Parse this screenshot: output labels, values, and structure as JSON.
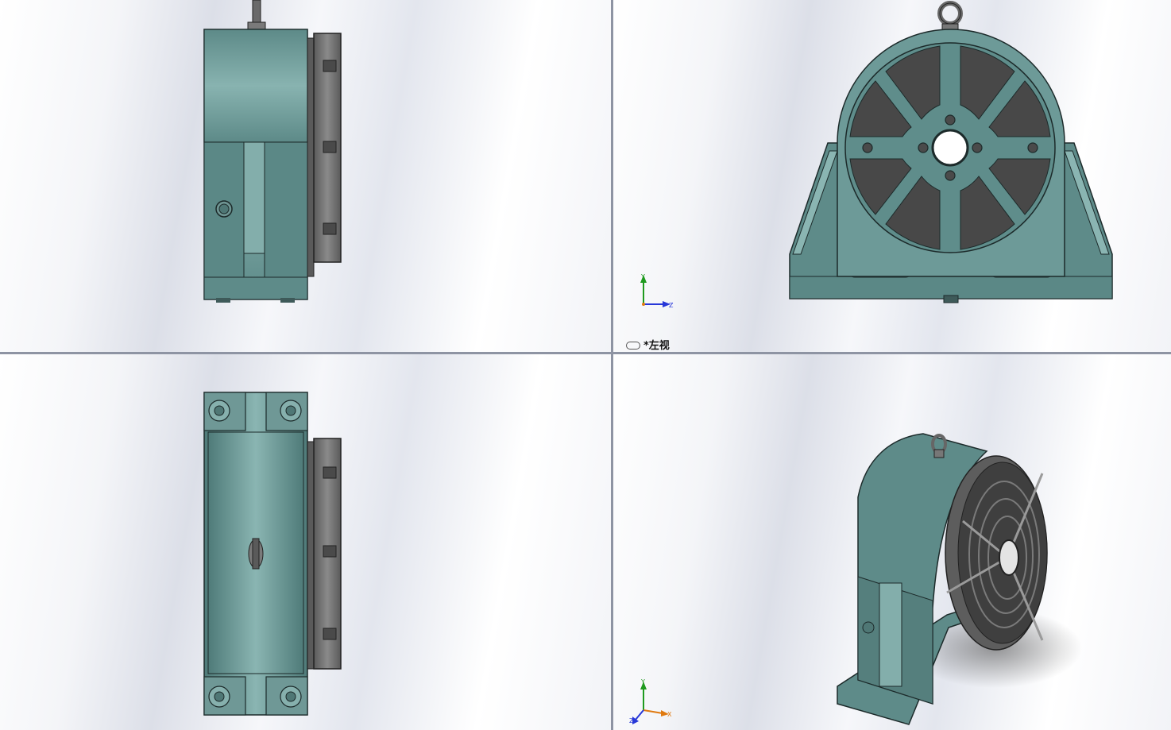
{
  "window": {
    "views": [
      {
        "id": "front",
        "name": "front-view"
      },
      {
        "id": "left",
        "name": "left-view"
      },
      {
        "id": "top",
        "name": "top-view"
      },
      {
        "id": "iso",
        "name": "isometric-view"
      }
    ]
  },
  "active_view_label": "*左视",
  "triad": {
    "x": "X",
    "y": "Y",
    "z": "Z"
  },
  "colors": {
    "body": "#5e8b89",
    "body_light": "#8cb7b4",
    "plate": "#6d6d6d",
    "slot": "#454545",
    "edge": "#1c2a2a",
    "triad_y": "#1f9a1f",
    "triad_z": "#2838d8",
    "triad_x": "#e07a10"
  }
}
